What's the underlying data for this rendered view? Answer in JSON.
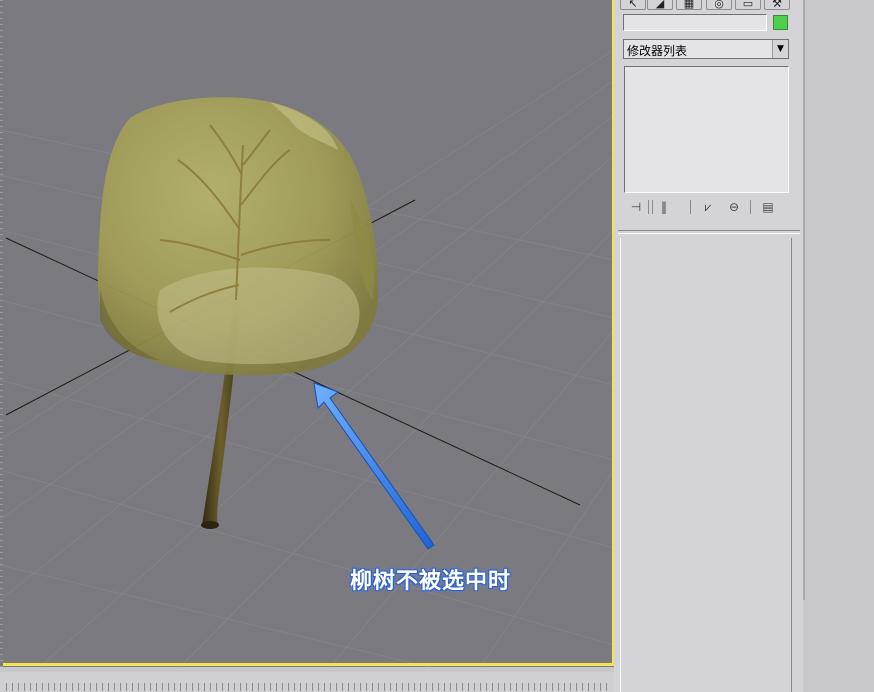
{
  "viewport": {
    "annotation": "柳树不被选中时"
  },
  "command_panel": {
    "tabs": [
      {
        "name": "create-tab",
        "glyph": "↖"
      },
      {
        "name": "modify-tab",
        "glyph": "◢"
      },
      {
        "name": "hierarchy-tab",
        "glyph": "▦"
      },
      {
        "name": "motion-tab",
        "glyph": "◎"
      },
      {
        "name": "display-tab",
        "glyph": "▭"
      },
      {
        "name": "utilities-tab",
        "glyph": "⚒"
      }
    ],
    "object_name": "",
    "object_color": "#4fcf4f",
    "modifier_list_label": "修改器列表",
    "stack_buttons": [
      {
        "name": "pin-stack-icon",
        "glyph": "⊣"
      },
      {
        "name": "show-end-result-icon",
        "glyph": "‖"
      },
      {
        "name": "make-unique-icon",
        "glyph": "⩗"
      },
      {
        "name": "remove-modifier-icon",
        "glyph": "⊖"
      },
      {
        "name": "configure-modifier-sets-icon",
        "glyph": "▤"
      }
    ]
  }
}
